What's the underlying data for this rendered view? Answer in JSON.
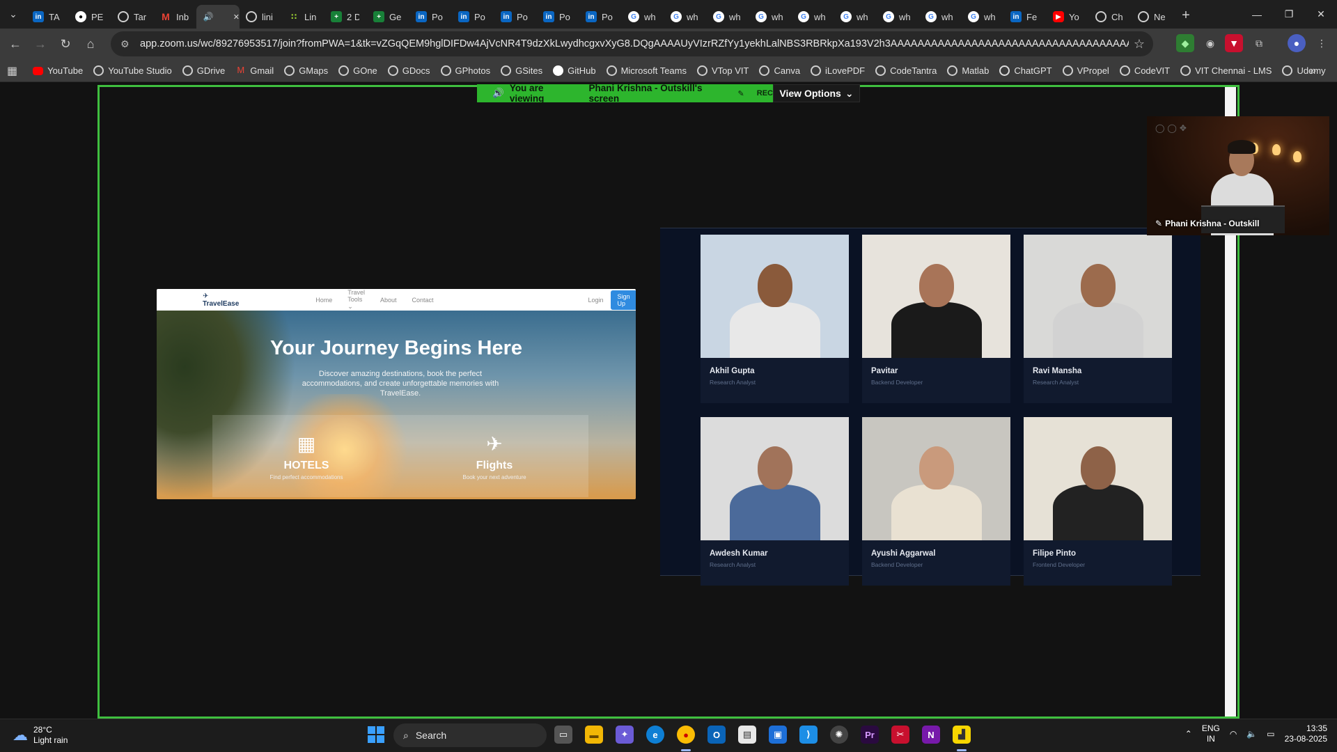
{
  "browser": {
    "tabs": [
      {
        "fav": "li",
        "label": "TA"
      },
      {
        "fav": "gh",
        "label": "PE"
      },
      {
        "fav": "globe",
        "label": "Tar"
      },
      {
        "fav": "gm",
        "label": "Inb"
      },
      {
        "fav": "speaker",
        "label": "",
        "active": true
      },
      {
        "fav": "globe",
        "label": "lini"
      },
      {
        "fav": "dots",
        "label": "Lin"
      },
      {
        "fav": "sheets",
        "label": "2 D"
      },
      {
        "fav": "sheets",
        "label": "Ge"
      },
      {
        "fav": "li",
        "label": "Po"
      },
      {
        "fav": "li",
        "label": "Po"
      },
      {
        "fav": "li",
        "label": "Po"
      },
      {
        "fav": "li",
        "label": "Po"
      },
      {
        "fav": "li",
        "label": "Po"
      },
      {
        "fav": "goog",
        "label": "wh"
      },
      {
        "fav": "goog",
        "label": "wh"
      },
      {
        "fav": "goog",
        "label": "wh"
      },
      {
        "fav": "goog",
        "label": "wh"
      },
      {
        "fav": "goog",
        "label": "wh"
      },
      {
        "fav": "goog",
        "label": "wh"
      },
      {
        "fav": "goog",
        "label": "wh"
      },
      {
        "fav": "goog",
        "label": "wh"
      },
      {
        "fav": "goog",
        "label": "wh"
      },
      {
        "fav": "li",
        "label": "Fe"
      },
      {
        "fav": "yt",
        "label": "Yo"
      },
      {
        "fav": "gpt",
        "label": "Ch"
      },
      {
        "fav": "gpt",
        "label": "Ne"
      }
    ],
    "url": "app.zoom.us/wc/89276953517/join?fromPWA=1&tk=vZGqQEM9hglDIFDw4AjVcNR4T9dzXkLwydhcgxvXyG8.DQgAAAAUyVIzrRZfYy1yekhLalNBS3RBRkpXa193V2h3AAAAAAAAAAAAAAAAAAAAAAAAAAAAAAAAAAAAAAAA&_x_zm_r...",
    "bookmarks": [
      {
        "icon": "yt",
        "label": "YouTube"
      },
      {
        "icon": "globe",
        "label": "YouTube Studio"
      },
      {
        "icon": "globe",
        "label": "GDrive"
      },
      {
        "icon": "gm",
        "label": "Gmail"
      },
      {
        "icon": "globe",
        "label": "GMaps"
      },
      {
        "icon": "globe",
        "label": "GOne"
      },
      {
        "icon": "globe",
        "label": "GDocs"
      },
      {
        "icon": "globe",
        "label": "GPhotos"
      },
      {
        "icon": "globe",
        "label": "GSites"
      },
      {
        "icon": "gh",
        "label": "GitHub"
      },
      {
        "icon": "globe",
        "label": "Microsoft Teams"
      },
      {
        "icon": "globe",
        "label": "VTop VIT"
      },
      {
        "icon": "globe",
        "label": "Canva"
      },
      {
        "icon": "globe",
        "label": "iLovePDF"
      },
      {
        "icon": "globe",
        "label": "CodeTantra"
      },
      {
        "icon": "globe",
        "label": "Matlab"
      },
      {
        "icon": "gpt",
        "label": "ChatGPT"
      },
      {
        "icon": "globe",
        "label": "VPropel"
      },
      {
        "icon": "globe",
        "label": "CodeVIT"
      },
      {
        "icon": "globe",
        "label": "VIT Chennai - LMS"
      },
      {
        "icon": "globe",
        "label": "Udemy"
      }
    ]
  },
  "zoom": {
    "banner_prefix": "You are viewing",
    "banner_name": "Phani Krishna - Outskill's screen",
    "rec": "REC",
    "view_options": "View Options",
    "participant_name": "Phani Krishna - Outskill"
  },
  "site": {
    "logo": "TravelEase",
    "nav": [
      "Home",
      "Travel Tools ⌄",
      "About",
      "Contact"
    ],
    "login": "Login",
    "signup": "Sign Up",
    "hero_title": "Your Journey Begins Here",
    "hero_sub": "Discover amazing destinations, book the perfect accommodations, and create unforgettable memories with TravelEase.",
    "cards": [
      {
        "title": "HOTELS",
        "sub": "Find perfect accommodations"
      },
      {
        "title": "Flights",
        "sub": "Book your next adventure"
      }
    ]
  },
  "team": [
    {
      "name": "Akhil Gupta",
      "role": "Research Analyst",
      "bg": "#c9d6e3",
      "skin": "#8a5a3b",
      "shirt": "#e8e8e8"
    },
    {
      "name": "Pavitar",
      "role": "Backend Developer",
      "bg": "#e7e3dc",
      "skin": "#a87458",
      "shirt": "#1a1a1a"
    },
    {
      "name": "Ravi Mansha",
      "role": "Research Analyst",
      "bg": "#d9d9d7",
      "skin": "#9c6b4d",
      "shirt": "#d2d2d2"
    },
    {
      "name": "Awdesh Kumar",
      "role": "Research Analyst",
      "bg": "#dcdcdc",
      "skin": "#a1735a",
      "shirt": "#4b6a9a"
    },
    {
      "name": "Ayushi Aggarwal",
      "role": "Backend Developer",
      "bg": "#c8c6c0",
      "skin": "#c99a7c",
      "shirt": "#e9e1d2"
    },
    {
      "name": "Filipe Pinto",
      "role": "Frontend Developer",
      "bg": "#e6e1d6",
      "skin": "#8e6248",
      "shirt": "#222222"
    }
  ],
  "taskbar": {
    "temp": "28°C",
    "weather": "Light rain",
    "search": "Search",
    "lang1": "ENG",
    "lang2": "IN",
    "time": "13:35",
    "date": "23-08-2025"
  },
  "colors": {
    "share_border": "#3fbf3f",
    "banner": "#2db52d"
  }
}
